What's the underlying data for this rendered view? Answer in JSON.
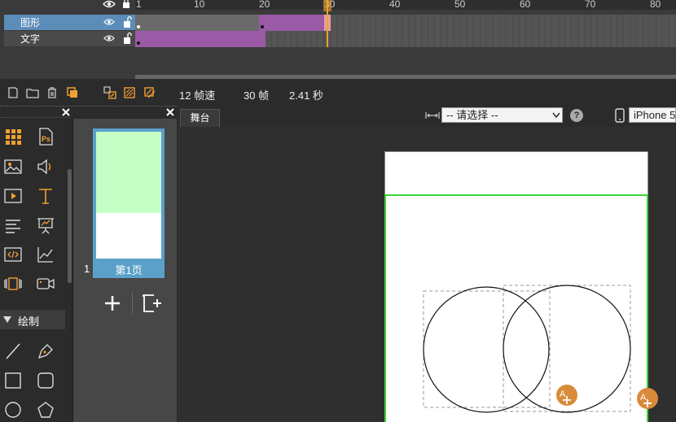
{
  "timeline": {
    "ruler_ticks": [
      "1",
      "10",
      "20",
      "30",
      "40",
      "50",
      "60",
      "70",
      "80"
    ],
    "layers": [
      {
        "name": "图形"
      },
      {
        "name": "文字"
      }
    ]
  },
  "toolbar": {
    "fps": "12 帧速",
    "frames": "30 帧",
    "seconds": "2.41 秒"
  },
  "tools": {
    "draw_section": "绘制"
  },
  "pages": {
    "page_number": "1",
    "page_label": "第1页"
  },
  "stage": {
    "tab_label": "舞台",
    "select_value": "-- 请选择 --",
    "device_value": "iPhone 5",
    "help_label": "?"
  },
  "colors": {
    "accent": "#f0a030",
    "selection_border": "#3bd43b",
    "thumb_green": "#c6ffc6",
    "layer_selected": "#5b8db8",
    "tween_purple": "#9a5aa6"
  }
}
